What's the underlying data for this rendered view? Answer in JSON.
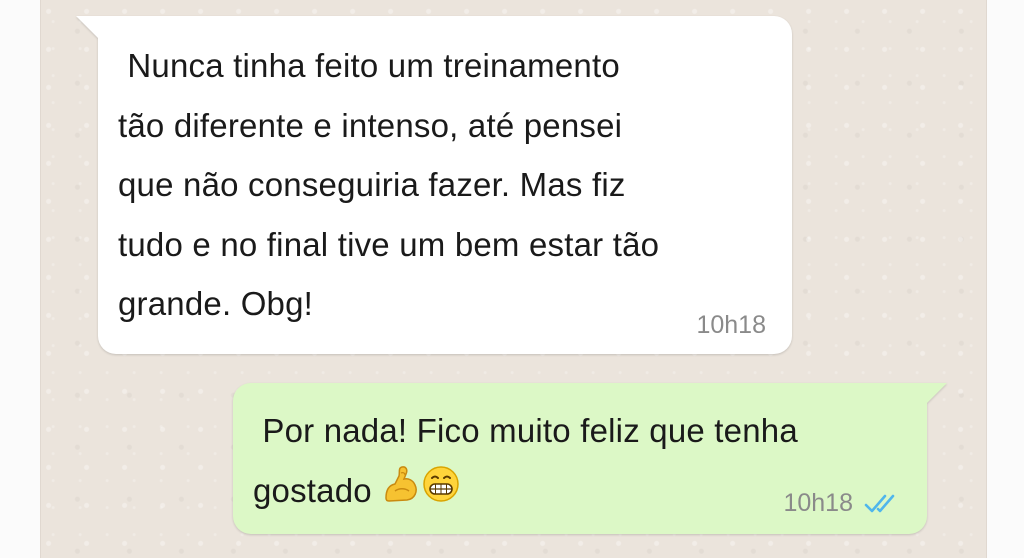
{
  "conversation": {
    "messages": [
      {
        "direction": "incoming",
        "text": " Nunca tinha feito um treinamento\ntão diferente e intenso, até pensei\nque não conseguiria fazer. Mas fiz\ntudo e no final tive um bem estar tão\ngrande. Obg!",
        "time": "10h18"
      },
      {
        "direction": "outgoing",
        "text": " Por nada! Fico muito feliz que tenha\ngostado ",
        "emojis": [
          "flexed-biceps-icon",
          "grinning-face-icon"
        ],
        "time": "10h18",
        "status": "read-double-check-icon"
      }
    ]
  },
  "colors": {
    "background": "#ebe4dc",
    "incoming_bubble": "#ffffff",
    "outgoing_bubble": "#dcf8c6",
    "timestamp": "#8a8a8a",
    "read_ticks": "#4fb6ec"
  }
}
